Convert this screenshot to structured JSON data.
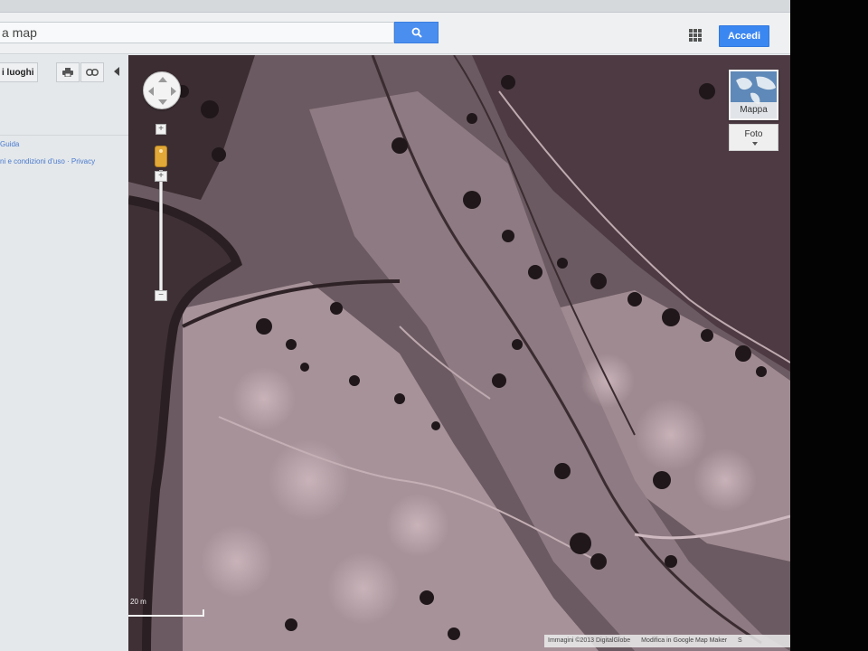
{
  "header": {
    "search_value": "a map",
    "signin_label": "Accedi"
  },
  "left_panel": {
    "places_label": "i luoghi",
    "guide_link": "Guida",
    "footer_links": "ni e condizioni d'uso · Privacy"
  },
  "map_controls": {
    "zoom_plus": "+",
    "zoom_minus": "−",
    "map_type_map": "Mappa",
    "map_type_photo": "Foto"
  },
  "scale": {
    "label": "20 m"
  },
  "attribution": {
    "imagery": "Immagini ©2013 DigitalGlobe",
    "report": "Modifica in Google Map Maker",
    "extra": "S"
  },
  "colors": {
    "accent": "#3b87f2",
    "search_button": "#4a8ef0",
    "link": "#4a7ad0"
  },
  "icons": [
    "search-icon",
    "apps-grid-icon",
    "print-icon",
    "link-icon",
    "collapse-arrow-icon",
    "pegman-icon",
    "globe-icon"
  ]
}
